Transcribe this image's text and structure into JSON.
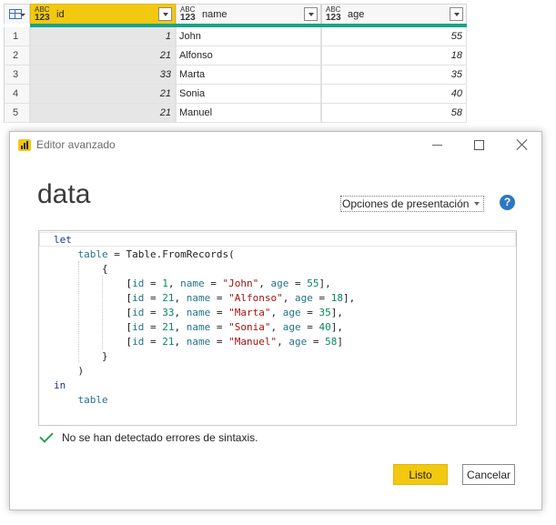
{
  "grid": {
    "columns": [
      {
        "type_top": "ABC",
        "type_bottom": "123",
        "name": "id"
      },
      {
        "type_top": "ABC",
        "type_bottom": "123",
        "name": "name"
      },
      {
        "type_top": "ABC",
        "type_bottom": "123",
        "name": "age"
      }
    ],
    "rows": [
      {
        "n": "1",
        "id": "1",
        "name": "John",
        "age": "55"
      },
      {
        "n": "2",
        "id": "21",
        "name": "Alfonso",
        "age": "18"
      },
      {
        "n": "3",
        "id": "33",
        "name": "Marta",
        "age": "35"
      },
      {
        "n": "4",
        "id": "21",
        "name": "Sonia",
        "age": "40"
      },
      {
        "n": "5",
        "id": "21",
        "name": "Manuel",
        "age": "58"
      }
    ]
  },
  "dialog": {
    "title": "Editor avanzado",
    "query_name": "data",
    "display_options": "Opciones de presentación",
    "help": "?",
    "status": "No se han detectado errores de sintaxis.",
    "done": "Listo",
    "cancel": "Cancelar"
  },
  "code": {
    "lines": [
      "let",
      "    table = Table.FromRecords(",
      "        {",
      "            [id = 1, name = \"John\", age = 55],",
      "            [id = 21, name = \"Alfonso\", age = 18],",
      "            [id = 33, name = \"Marta\", age = 35],",
      "            [id = 21, name = \"Sonia\", age = 40],",
      "            [id = 21, name = \"Manuel\", age = 58]",
      "        }",
      "    )",
      "in",
      "    table"
    ]
  },
  "colors": {
    "accent": "#f2c811",
    "column_quality": "#16a38a",
    "keyword": "#1f2f9c",
    "identifier": "#257387",
    "string": "#a31515",
    "number": "#098658",
    "success": "#2e9e4e"
  },
  "icons": {
    "table": "table-icon",
    "type": "any-type-icon",
    "filter": "filter-dropdown-icon",
    "app": "power-bi-icon",
    "help": "help-icon",
    "check": "check-icon"
  }
}
